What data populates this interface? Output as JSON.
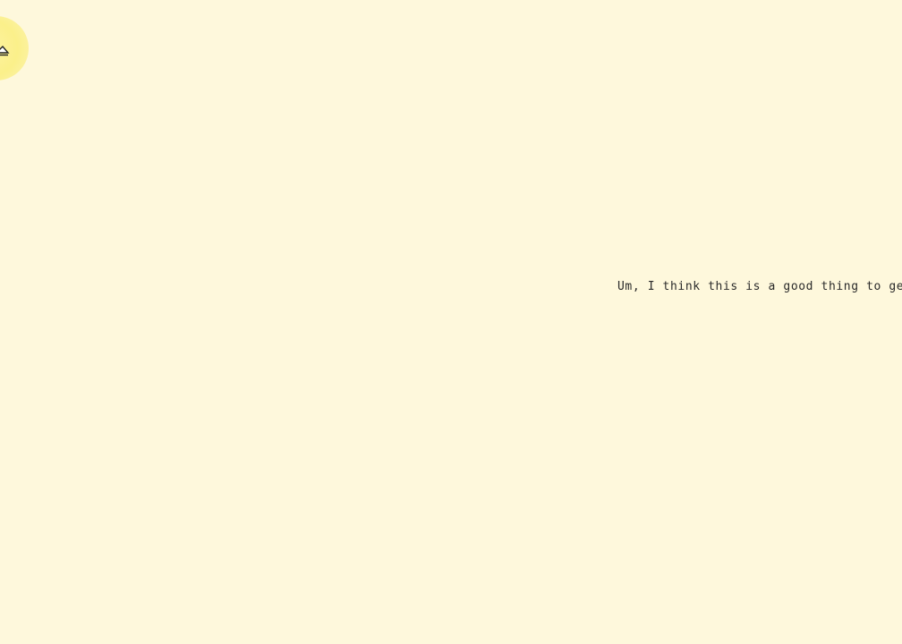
{
  "canvas": {
    "background_color": "#fef8dc",
    "highlight_color": "#fbf08a"
  },
  "cursor": {
    "icon": "pointer-icon"
  },
  "dialogue": {
    "text": "Um, I think this is a good thing to ge"
  }
}
